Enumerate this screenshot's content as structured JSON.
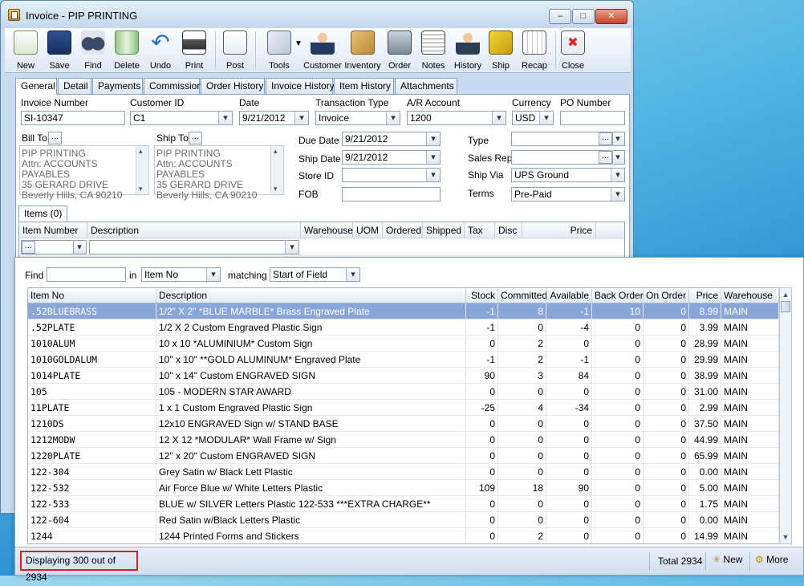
{
  "window": {
    "title": "Invoice - PIP PRINTING"
  },
  "toolbar": [
    {
      "label": "New",
      "icon": "new-document-icon"
    },
    {
      "label": "Save",
      "icon": "floppy-disk-icon"
    },
    {
      "label": "Find",
      "icon": "binoculars-icon"
    },
    {
      "label": "Delete",
      "icon": "trash-bin-icon"
    },
    {
      "label": "Undo",
      "icon": "undo-arrow-icon"
    },
    {
      "label": "Print",
      "icon": "printer-icon"
    },
    {
      "label": "Post",
      "icon": "post-document-icon"
    },
    {
      "label": "Tools",
      "icon": "tools-icon"
    },
    {
      "label": "Customer",
      "icon": "customer-person-icon"
    },
    {
      "label": "Inventory",
      "icon": "inventory-boxes-icon"
    },
    {
      "label": "Order",
      "icon": "order-register-icon"
    },
    {
      "label": "Notes",
      "icon": "notes-pad-icon"
    },
    {
      "label": "History",
      "icon": "history-person-icon"
    },
    {
      "label": "Ship",
      "icon": "forklift-icon"
    },
    {
      "label": "Recap",
      "icon": "recap-calculator-icon"
    },
    {
      "label": "Close",
      "icon": "close-window-icon"
    }
  ],
  "tabs": [
    "General",
    "Detail",
    "Payments",
    "Commission",
    "Order History",
    "Invoice History",
    "Item History",
    "Attachments"
  ],
  "form": {
    "invoice_number_label": "Invoice Number",
    "invoice_number": "SI-10347",
    "customer_id_label": "Customer ID",
    "customer_id": "C1",
    "date_label": "Date",
    "date": "9/21/2012",
    "transaction_type_label": "Transaction Type",
    "transaction_type": "Invoice",
    "ar_account_label": "A/R Account",
    "ar_account": "1200",
    "currency_label": "Currency",
    "currency": "USD",
    "po_number_label": "PO Number",
    "po_number": "",
    "bill_to_label": "Bill To",
    "bill_to_lines": [
      "PIP PRINTING",
      "Attn: ACCOUNTS PAYABLES",
      "35 GERARD DRIVE",
      "Beverly Hills, CA 90210"
    ],
    "ship_to_label": "Ship To",
    "ship_to_lines": [
      "PIP PRINTING",
      "Attn: ACCOUNTS PAYABLES",
      "35 GERARD DRIVE",
      "Beverly Hills, CA 90210"
    ],
    "due_date_label": "Due Date",
    "due_date": "9/21/2012",
    "ship_date_label": "Ship Date",
    "ship_date": "9/21/2012",
    "store_id_label": "Store ID",
    "store_id": "",
    "fob_label": "FOB",
    "fob": "",
    "type_label": "Type",
    "type": "",
    "sales_rep_label": "Sales Rep",
    "sales_rep": "",
    "ship_via_label": "Ship Via",
    "ship_via": "UPS Ground",
    "terms_label": "Terms",
    "terms": "Pre-Paid"
  },
  "items": {
    "tab_label": "Items (0)",
    "columns": [
      "Item Number",
      "Description",
      "Warehouse",
      "UOM",
      "Ordered",
      "Shipped",
      "Tax",
      "Disc",
      "Price"
    ]
  },
  "lookup": {
    "find_label": "Find",
    "find_value": "",
    "in_label": "in",
    "in_value": "Item No",
    "matching_label": "matching",
    "matching_value": "Start of Field",
    "columns": [
      "Item No",
      "Description",
      "Stock",
      "Committed",
      "Available",
      "Back Order",
      "On Order",
      "Price",
      "Warehouse"
    ],
    "rows": [
      [
        ".52BLUEBRASS",
        "1/2\" X 2\"  *BLUE MARBLE* Brass  Engraved Plate",
        "-1",
        "8",
        "-1",
        "10",
        "0",
        "8.99",
        "MAIN"
      ],
      [
        ".52PLATE",
        "1/2  X  2  Custom Engraved Plastic Sign",
        "-1",
        "0",
        "-4",
        "0",
        "0",
        "3.99",
        "MAIN"
      ],
      [
        "1010ALUM",
        "10 x 10 *ALUMINIUM* Custom Sign",
        "0",
        "2",
        "0",
        "0",
        "0",
        "28.99",
        "MAIN"
      ],
      [
        "1010GOLDALUM",
        "10\" x 10\" **GOLD ALUMINUM* Engraved Plate",
        "-1",
        "2",
        "-1",
        "0",
        "0",
        "29.99",
        "MAIN"
      ],
      [
        "1014PLATE",
        "10\" x 14\"  Custom ENGRAVED SIGN",
        "90",
        "3",
        "84",
        "0",
        "0",
        "38.99",
        "MAIN"
      ],
      [
        "105",
        "105 - MODERN STAR AWARD",
        "0",
        "0",
        "0",
        "0",
        "0",
        "31.00",
        "MAIN"
      ],
      [
        "11PLATE",
        "1 x 1  Custom Engraved Plastic Sign",
        "-25",
        "4",
        "-34",
        "0",
        "0",
        "2.99",
        "MAIN"
      ],
      [
        "1210DS",
        "12x10 ENGRAVED Sign w/ STAND BASE",
        "0",
        "0",
        "0",
        "0",
        "0",
        "37.50",
        "MAIN"
      ],
      [
        "1212MODW",
        "12 X 12 *MODULAR* Wall Frame w/ Sign",
        "0",
        "0",
        "0",
        "0",
        "0",
        "44.99",
        "MAIN"
      ],
      [
        "1220PLATE",
        "12\" x 20\" Custom ENGRAVED SIGN",
        "0",
        "0",
        "0",
        "0",
        "0",
        "65.99",
        "MAIN"
      ],
      [
        "122-304",
        "Grey Satin w/ Black Lett Plastic",
        "0",
        "0",
        "0",
        "0",
        "0",
        "0.00",
        "MAIN"
      ],
      [
        "122-532",
        "Air Force Blue w/ White Letters Plastic",
        "109",
        "18",
        "90",
        "0",
        "0",
        "5.00",
        "MAIN"
      ],
      [
        "122-533",
        "BLUE w/ SILVER Letters Plastic 122-533 ***EXTRA CHARGE**",
        "0",
        "0",
        "0",
        "0",
        "0",
        "1.75",
        "MAIN"
      ],
      [
        "122-604",
        "Red Satin w/Black Letters Plastic",
        "0",
        "0",
        "0",
        "0",
        "0",
        "0.00",
        "MAIN"
      ],
      [
        "1244",
        "1244  Printed Forms and Stickers",
        "0",
        "2",
        "0",
        "0",
        "0",
        "14.99",
        "MAIN"
      ]
    ],
    "status_text": "Displaying 300 out of 2934",
    "total_text": "Total 2934",
    "new_label": "New",
    "more_label": "More"
  }
}
